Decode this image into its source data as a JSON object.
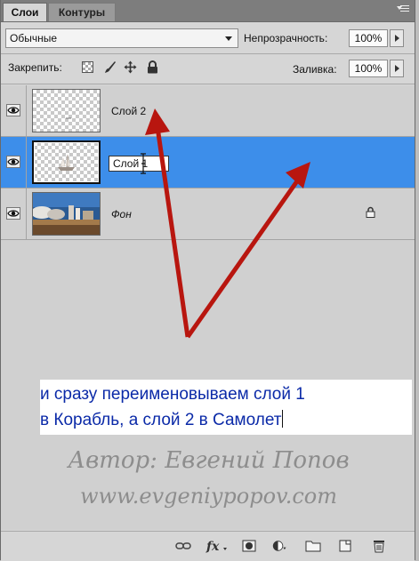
{
  "tabs": [
    {
      "label": "Слои",
      "active": true
    },
    {
      "label": "Контуры",
      "active": false
    }
  ],
  "blend_mode": {
    "value": "Обычные"
  },
  "opacity": {
    "label": "Непрозрачность:",
    "value": "100%"
  },
  "lock": {
    "label": "Закрепить:",
    "icons": [
      "lock-transparent-pixels-icon",
      "lock-image-pixels-icon",
      "lock-position-icon",
      "lock-all-icon"
    ]
  },
  "fill": {
    "label": "Заливка:",
    "value": "100%"
  },
  "layers": [
    {
      "name": "Слой 2",
      "visible": true,
      "selected": false
    },
    {
      "name": "Слой 1",
      "visible": true,
      "selected": true,
      "renaming": true
    },
    {
      "name": "Фон",
      "visible": true,
      "selected": false,
      "locked": true
    }
  ],
  "annotation": {
    "line1": "и сразу переименовываем слой 1",
    "line2": "в Корабль, а слой 2 в Самолет"
  },
  "watermark": {
    "line1": "Автор: Евгений Попов",
    "line2": "www.evgeniypopov.com"
  },
  "bottom_icons": [
    "link-layers-icon",
    "fx-icon",
    "add-mask-icon",
    "adjustment-layer-icon",
    "new-group-icon",
    "new-layer-icon",
    "trash-icon"
  ],
  "colors": {
    "selection": "#3d8eea",
    "arrow": "#b8160f",
    "annotation_text": "#0b2aa8"
  }
}
